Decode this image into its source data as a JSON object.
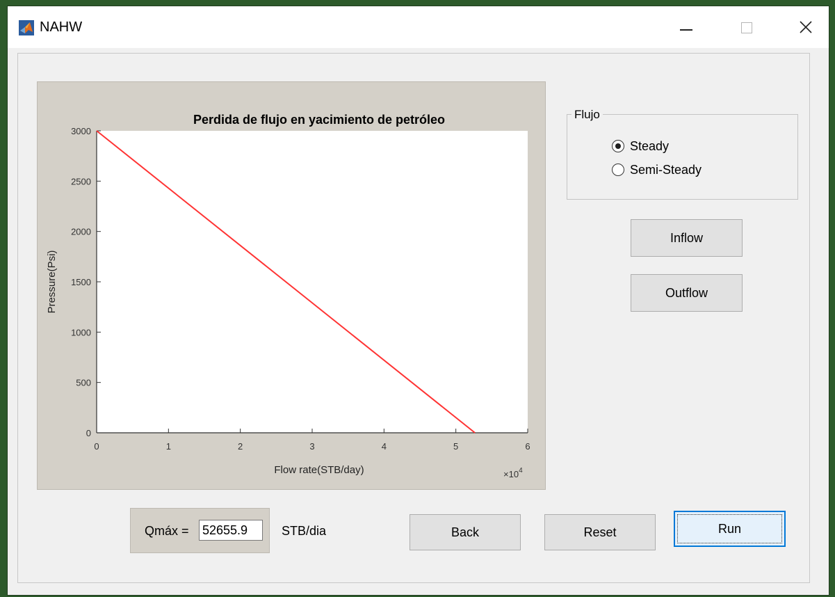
{
  "window": {
    "title": "NAHW",
    "icon": "matlab-icon",
    "controls": {
      "minimize": "minimize-icon",
      "maximize": "maximize-icon",
      "close": "close-icon"
    }
  },
  "chart_data": {
    "type": "line",
    "title": "Perdida de flujo en yacimiento de petróleo",
    "xlabel": "Flow rate(STB/day)",
    "ylabel": "Pressure(Psi)",
    "x_exponent_label": "×10",
    "x_exponent_power": "4",
    "xlim": [
      0,
      6
    ],
    "ylim": [
      0,
      3000
    ],
    "x_ticks": [
      "0",
      "1",
      "2",
      "3",
      "4",
      "5",
      "6"
    ],
    "x_tick_values": [
      0,
      1,
      2,
      3,
      4,
      5,
      6
    ],
    "y_ticks": [
      "0",
      "500",
      "1000",
      "1500",
      "2000",
      "2500",
      "3000"
    ],
    "y_tick_values": [
      0,
      500,
      1000,
      1500,
      2000,
      2500,
      3000
    ],
    "grid": false,
    "line_color": "#ff3333",
    "series": [
      {
        "x": [
          0,
          5.26559
        ],
        "y": [
          3000,
          0
        ]
      }
    ]
  },
  "flujo": {
    "legend": "Flujo",
    "options": [
      {
        "label": "Steady",
        "selected": true
      },
      {
        "label": "Semi-Steady",
        "selected": false
      }
    ]
  },
  "buttons": {
    "inflow": "Inflow",
    "outflow": "Outflow",
    "back": "Back",
    "reset": "Reset",
    "run": "Run"
  },
  "qmax": {
    "label": "Qmáx =",
    "value": "52655.9",
    "unit": "STB/dia"
  }
}
